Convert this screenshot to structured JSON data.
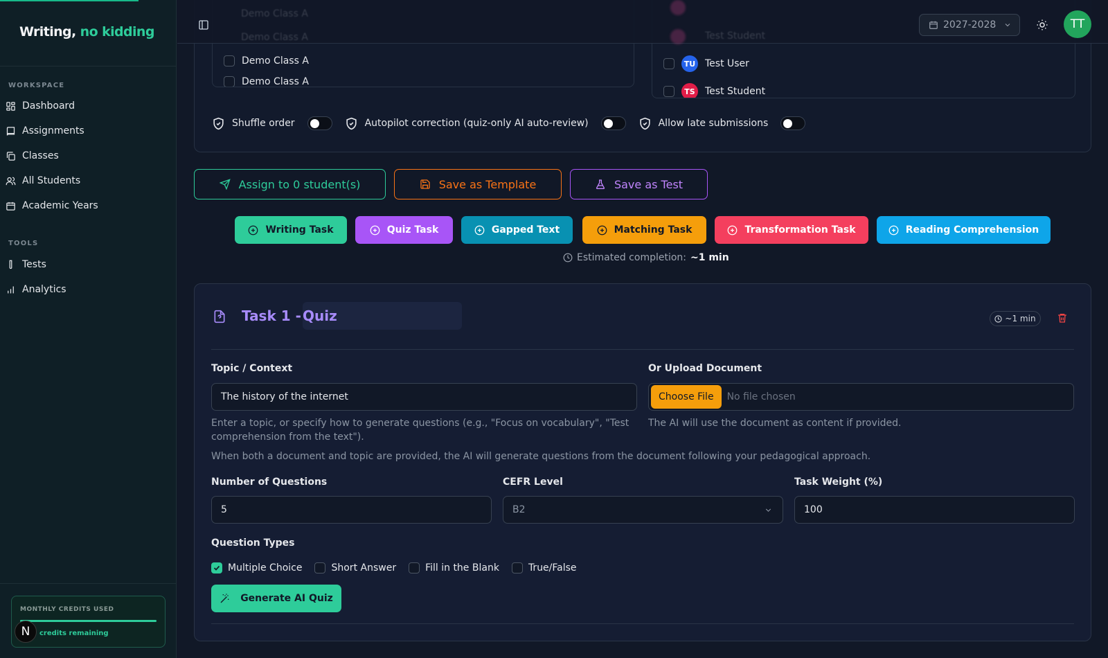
{
  "brand": {
    "part1": "Writing,",
    "part2": "no kidding"
  },
  "sidebar": {
    "workspace_heading": "WORKSPACE",
    "workspace_items": [
      {
        "label": "Dashboard",
        "icon": "dashboard-icon"
      },
      {
        "label": "Assignments",
        "icon": "book-icon"
      },
      {
        "label": "Classes",
        "icon": "copy-icon"
      },
      {
        "label": "All Students",
        "icon": "users-icon"
      },
      {
        "label": "Academic Years",
        "icon": "calendar-icon"
      }
    ],
    "tools_heading": "TOOLS",
    "tools_items": [
      {
        "label": "Tests",
        "icon": "test-tube-icon"
      },
      {
        "label": "Analytics",
        "icon": "bar-chart-icon"
      }
    ],
    "credits": {
      "label": "MONTHLY CREDITS USED",
      "remaining_text": "credits remaining",
      "used_fraction": 1.0
    },
    "bottom_avatar": "N"
  },
  "header": {
    "academic_year": "2027-2028",
    "avatar_initials": "TT",
    "ghost_class": "Demo Class A",
    "ghost_student": "Test Student"
  },
  "classes_list": {
    "items": [
      "Demo Class A",
      "Demo Class A"
    ]
  },
  "students_list": {
    "items": [
      {
        "initials": "TU",
        "name": "Test User",
        "color": "#2563eb"
      },
      {
        "initials": "TS",
        "name": "Test Student",
        "color": "#e11d48"
      }
    ]
  },
  "options": {
    "shuffle": {
      "label": "Shuffle order",
      "on": false
    },
    "autopilot": {
      "label": "Autopilot correction (quiz-only AI auto-review)",
      "on": false
    },
    "late": {
      "label": "Allow late submissions",
      "on": false
    }
  },
  "actions": {
    "assign": "Assign to 0 student(s)",
    "save_template": "Save as Template",
    "save_test": "Save as Test"
  },
  "task_types": [
    {
      "label": "Writing Task",
      "color": "#2ecc9a"
    },
    {
      "label": "Quiz Task",
      "color": "#a855f7"
    },
    {
      "label": "Gapped Text",
      "color": "#0891b2"
    },
    {
      "label": "Matching Task",
      "color": "#f59e0b"
    },
    {
      "label": "Transformation Task",
      "color": "#f43f5e"
    },
    {
      "label": "Reading Comprehension",
      "color": "#0ea5e9"
    }
  ],
  "estimate": {
    "label": "Estimated completion:",
    "value": "~1 min"
  },
  "task": {
    "label": "Task 1 -",
    "title": "Quiz",
    "time": "~1 min",
    "topic_label": "Topic / Context",
    "topic_value": "The history of the internet",
    "topic_help": "Enter a topic, or specify how to generate questions (e.g., \"Focus on vocabulary\", \"Test comprehension from the text\").",
    "upload_label": "Or Upload Document",
    "choose_file": "Choose File",
    "no_file": "No file chosen",
    "upload_help": "The AI will use the document as content if provided.",
    "both_help": "When both a document and topic are provided, the AI will generate questions from the document following your pedagogical approach.",
    "num_questions_label": "Number of Questions",
    "num_questions_value": "5",
    "cefr_label": "CEFR Level",
    "cefr_value": "B2",
    "weight_label": "Task Weight (%)",
    "weight_value": "100",
    "question_types_label": "Question Types",
    "question_types": [
      {
        "label": "Multiple Choice",
        "checked": true
      },
      {
        "label": "Short Answer",
        "checked": false
      },
      {
        "label": "Fill in the Blank",
        "checked": false
      },
      {
        "label": "True/False",
        "checked": false
      }
    ],
    "generate_label": "Generate AI Quiz"
  }
}
